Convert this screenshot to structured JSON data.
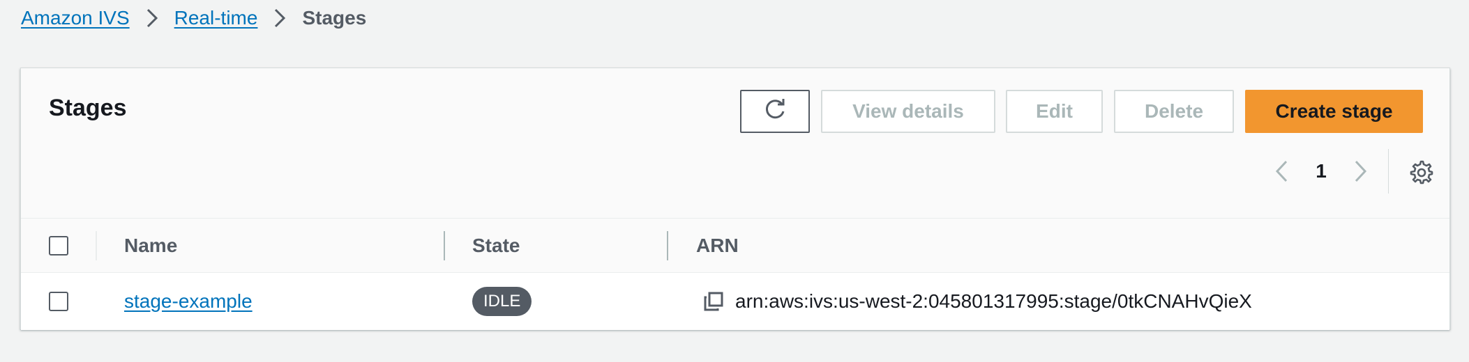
{
  "breadcrumb": {
    "items": [
      {
        "label": "Amazon IVS"
      },
      {
        "label": "Real-time"
      }
    ],
    "current": "Stages"
  },
  "panel": {
    "title": "Stages",
    "buttons": {
      "view_details": "View details",
      "edit": "Edit",
      "delete": "Delete",
      "create": "Create stage"
    },
    "pagination": {
      "current_page": "1"
    }
  },
  "table": {
    "columns": [
      "Name",
      "State",
      "ARN"
    ],
    "rows": [
      {
        "name": "stage-example",
        "state": "IDLE",
        "arn": "arn:aws:ivs:us-west-2:045801317995:stage/0tkCNAHvQieX"
      }
    ]
  },
  "icons": {
    "refresh": "refresh-icon",
    "settings": "gear-icon",
    "copy": "copy-icon",
    "prev": "chevron-left-icon",
    "next": "chevron-right-icon",
    "separator": "chevron-right-icon"
  },
  "colors": {
    "link": "#0073bb",
    "primary_button": "#f2962f",
    "badge": "#545b64"
  }
}
